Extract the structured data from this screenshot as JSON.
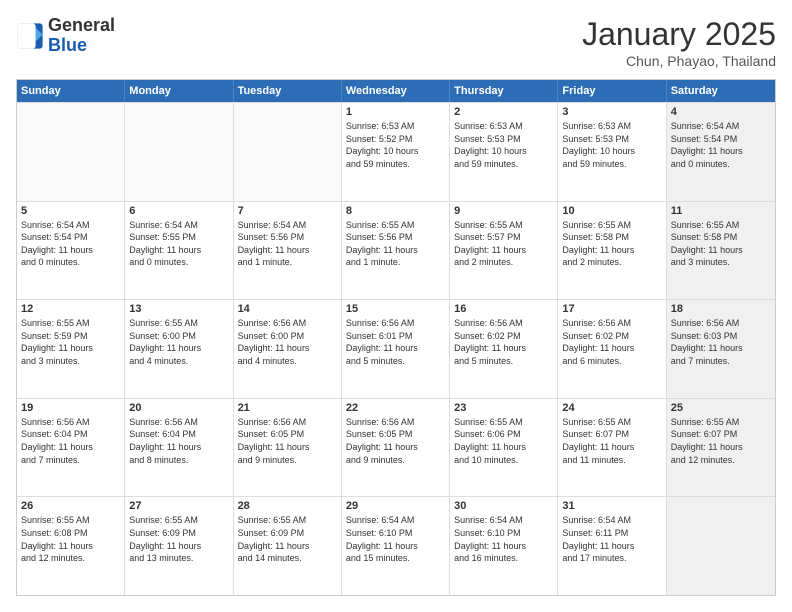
{
  "logo": {
    "general": "General",
    "blue": "Blue"
  },
  "header": {
    "month": "January 2025",
    "location": "Chun, Phayao, Thailand"
  },
  "days": [
    "Sunday",
    "Monday",
    "Tuesday",
    "Wednesday",
    "Thursday",
    "Friday",
    "Saturday"
  ],
  "rows": [
    [
      {
        "day": "",
        "empty": true
      },
      {
        "day": "",
        "empty": true
      },
      {
        "day": "",
        "empty": true
      },
      {
        "day": "1",
        "line1": "Sunrise: 6:53 AM",
        "line2": "Sunset: 5:52 PM",
        "line3": "Daylight: 10 hours",
        "line4": "and 59 minutes."
      },
      {
        "day": "2",
        "line1": "Sunrise: 6:53 AM",
        "line2": "Sunset: 5:53 PM",
        "line3": "Daylight: 10 hours",
        "line4": "and 59 minutes."
      },
      {
        "day": "3",
        "line1": "Sunrise: 6:53 AM",
        "line2": "Sunset: 5:53 PM",
        "line3": "Daylight: 10 hours",
        "line4": "and 59 minutes."
      },
      {
        "day": "4",
        "line1": "Sunrise: 6:54 AM",
        "line2": "Sunset: 5:54 PM",
        "line3": "Daylight: 11 hours",
        "line4": "and 0 minutes.",
        "shaded": true
      }
    ],
    [
      {
        "day": "5",
        "line1": "Sunrise: 6:54 AM",
        "line2": "Sunset: 5:54 PM",
        "line3": "Daylight: 11 hours",
        "line4": "and 0 minutes."
      },
      {
        "day": "6",
        "line1": "Sunrise: 6:54 AM",
        "line2": "Sunset: 5:55 PM",
        "line3": "Daylight: 11 hours",
        "line4": "and 0 minutes."
      },
      {
        "day": "7",
        "line1": "Sunrise: 6:54 AM",
        "line2": "Sunset: 5:56 PM",
        "line3": "Daylight: 11 hours",
        "line4": "and 1 minute."
      },
      {
        "day": "8",
        "line1": "Sunrise: 6:55 AM",
        "line2": "Sunset: 5:56 PM",
        "line3": "Daylight: 11 hours",
        "line4": "and 1 minute."
      },
      {
        "day": "9",
        "line1": "Sunrise: 6:55 AM",
        "line2": "Sunset: 5:57 PM",
        "line3": "Daylight: 11 hours",
        "line4": "and 2 minutes."
      },
      {
        "day": "10",
        "line1": "Sunrise: 6:55 AM",
        "line2": "Sunset: 5:58 PM",
        "line3": "Daylight: 11 hours",
        "line4": "and 2 minutes."
      },
      {
        "day": "11",
        "line1": "Sunrise: 6:55 AM",
        "line2": "Sunset: 5:58 PM",
        "line3": "Daylight: 11 hours",
        "line4": "and 3 minutes.",
        "shaded": true
      }
    ],
    [
      {
        "day": "12",
        "line1": "Sunrise: 6:55 AM",
        "line2": "Sunset: 5:59 PM",
        "line3": "Daylight: 11 hours",
        "line4": "and 3 minutes."
      },
      {
        "day": "13",
        "line1": "Sunrise: 6:55 AM",
        "line2": "Sunset: 6:00 PM",
        "line3": "Daylight: 11 hours",
        "line4": "and 4 minutes."
      },
      {
        "day": "14",
        "line1": "Sunrise: 6:56 AM",
        "line2": "Sunset: 6:00 PM",
        "line3": "Daylight: 11 hours",
        "line4": "and 4 minutes."
      },
      {
        "day": "15",
        "line1": "Sunrise: 6:56 AM",
        "line2": "Sunset: 6:01 PM",
        "line3": "Daylight: 11 hours",
        "line4": "and 5 minutes."
      },
      {
        "day": "16",
        "line1": "Sunrise: 6:56 AM",
        "line2": "Sunset: 6:02 PM",
        "line3": "Daylight: 11 hours",
        "line4": "and 5 minutes."
      },
      {
        "day": "17",
        "line1": "Sunrise: 6:56 AM",
        "line2": "Sunset: 6:02 PM",
        "line3": "Daylight: 11 hours",
        "line4": "and 6 minutes."
      },
      {
        "day": "18",
        "line1": "Sunrise: 6:56 AM",
        "line2": "Sunset: 6:03 PM",
        "line3": "Daylight: 11 hours",
        "line4": "and 7 minutes.",
        "shaded": true
      }
    ],
    [
      {
        "day": "19",
        "line1": "Sunrise: 6:56 AM",
        "line2": "Sunset: 6:04 PM",
        "line3": "Daylight: 11 hours",
        "line4": "and 7 minutes."
      },
      {
        "day": "20",
        "line1": "Sunrise: 6:56 AM",
        "line2": "Sunset: 6:04 PM",
        "line3": "Daylight: 11 hours",
        "line4": "and 8 minutes."
      },
      {
        "day": "21",
        "line1": "Sunrise: 6:56 AM",
        "line2": "Sunset: 6:05 PM",
        "line3": "Daylight: 11 hours",
        "line4": "and 9 minutes."
      },
      {
        "day": "22",
        "line1": "Sunrise: 6:56 AM",
        "line2": "Sunset: 6:05 PM",
        "line3": "Daylight: 11 hours",
        "line4": "and 9 minutes."
      },
      {
        "day": "23",
        "line1": "Sunrise: 6:55 AM",
        "line2": "Sunset: 6:06 PM",
        "line3": "Daylight: 11 hours",
        "line4": "and 10 minutes."
      },
      {
        "day": "24",
        "line1": "Sunrise: 6:55 AM",
        "line2": "Sunset: 6:07 PM",
        "line3": "Daylight: 11 hours",
        "line4": "and 11 minutes."
      },
      {
        "day": "25",
        "line1": "Sunrise: 6:55 AM",
        "line2": "Sunset: 6:07 PM",
        "line3": "Daylight: 11 hours",
        "line4": "and 12 minutes.",
        "shaded": true
      }
    ],
    [
      {
        "day": "26",
        "line1": "Sunrise: 6:55 AM",
        "line2": "Sunset: 6:08 PM",
        "line3": "Daylight: 11 hours",
        "line4": "and 12 minutes."
      },
      {
        "day": "27",
        "line1": "Sunrise: 6:55 AM",
        "line2": "Sunset: 6:09 PM",
        "line3": "Daylight: 11 hours",
        "line4": "and 13 minutes."
      },
      {
        "day": "28",
        "line1": "Sunrise: 6:55 AM",
        "line2": "Sunset: 6:09 PM",
        "line3": "Daylight: 11 hours",
        "line4": "and 14 minutes."
      },
      {
        "day": "29",
        "line1": "Sunrise: 6:54 AM",
        "line2": "Sunset: 6:10 PM",
        "line3": "Daylight: 11 hours",
        "line4": "and 15 minutes."
      },
      {
        "day": "30",
        "line1": "Sunrise: 6:54 AM",
        "line2": "Sunset: 6:10 PM",
        "line3": "Daylight: 11 hours",
        "line4": "and 16 minutes."
      },
      {
        "day": "31",
        "line1": "Sunrise: 6:54 AM",
        "line2": "Sunset: 6:11 PM",
        "line3": "Daylight: 11 hours",
        "line4": "and 17 minutes."
      },
      {
        "day": "",
        "empty": true,
        "shaded": true
      }
    ]
  ]
}
